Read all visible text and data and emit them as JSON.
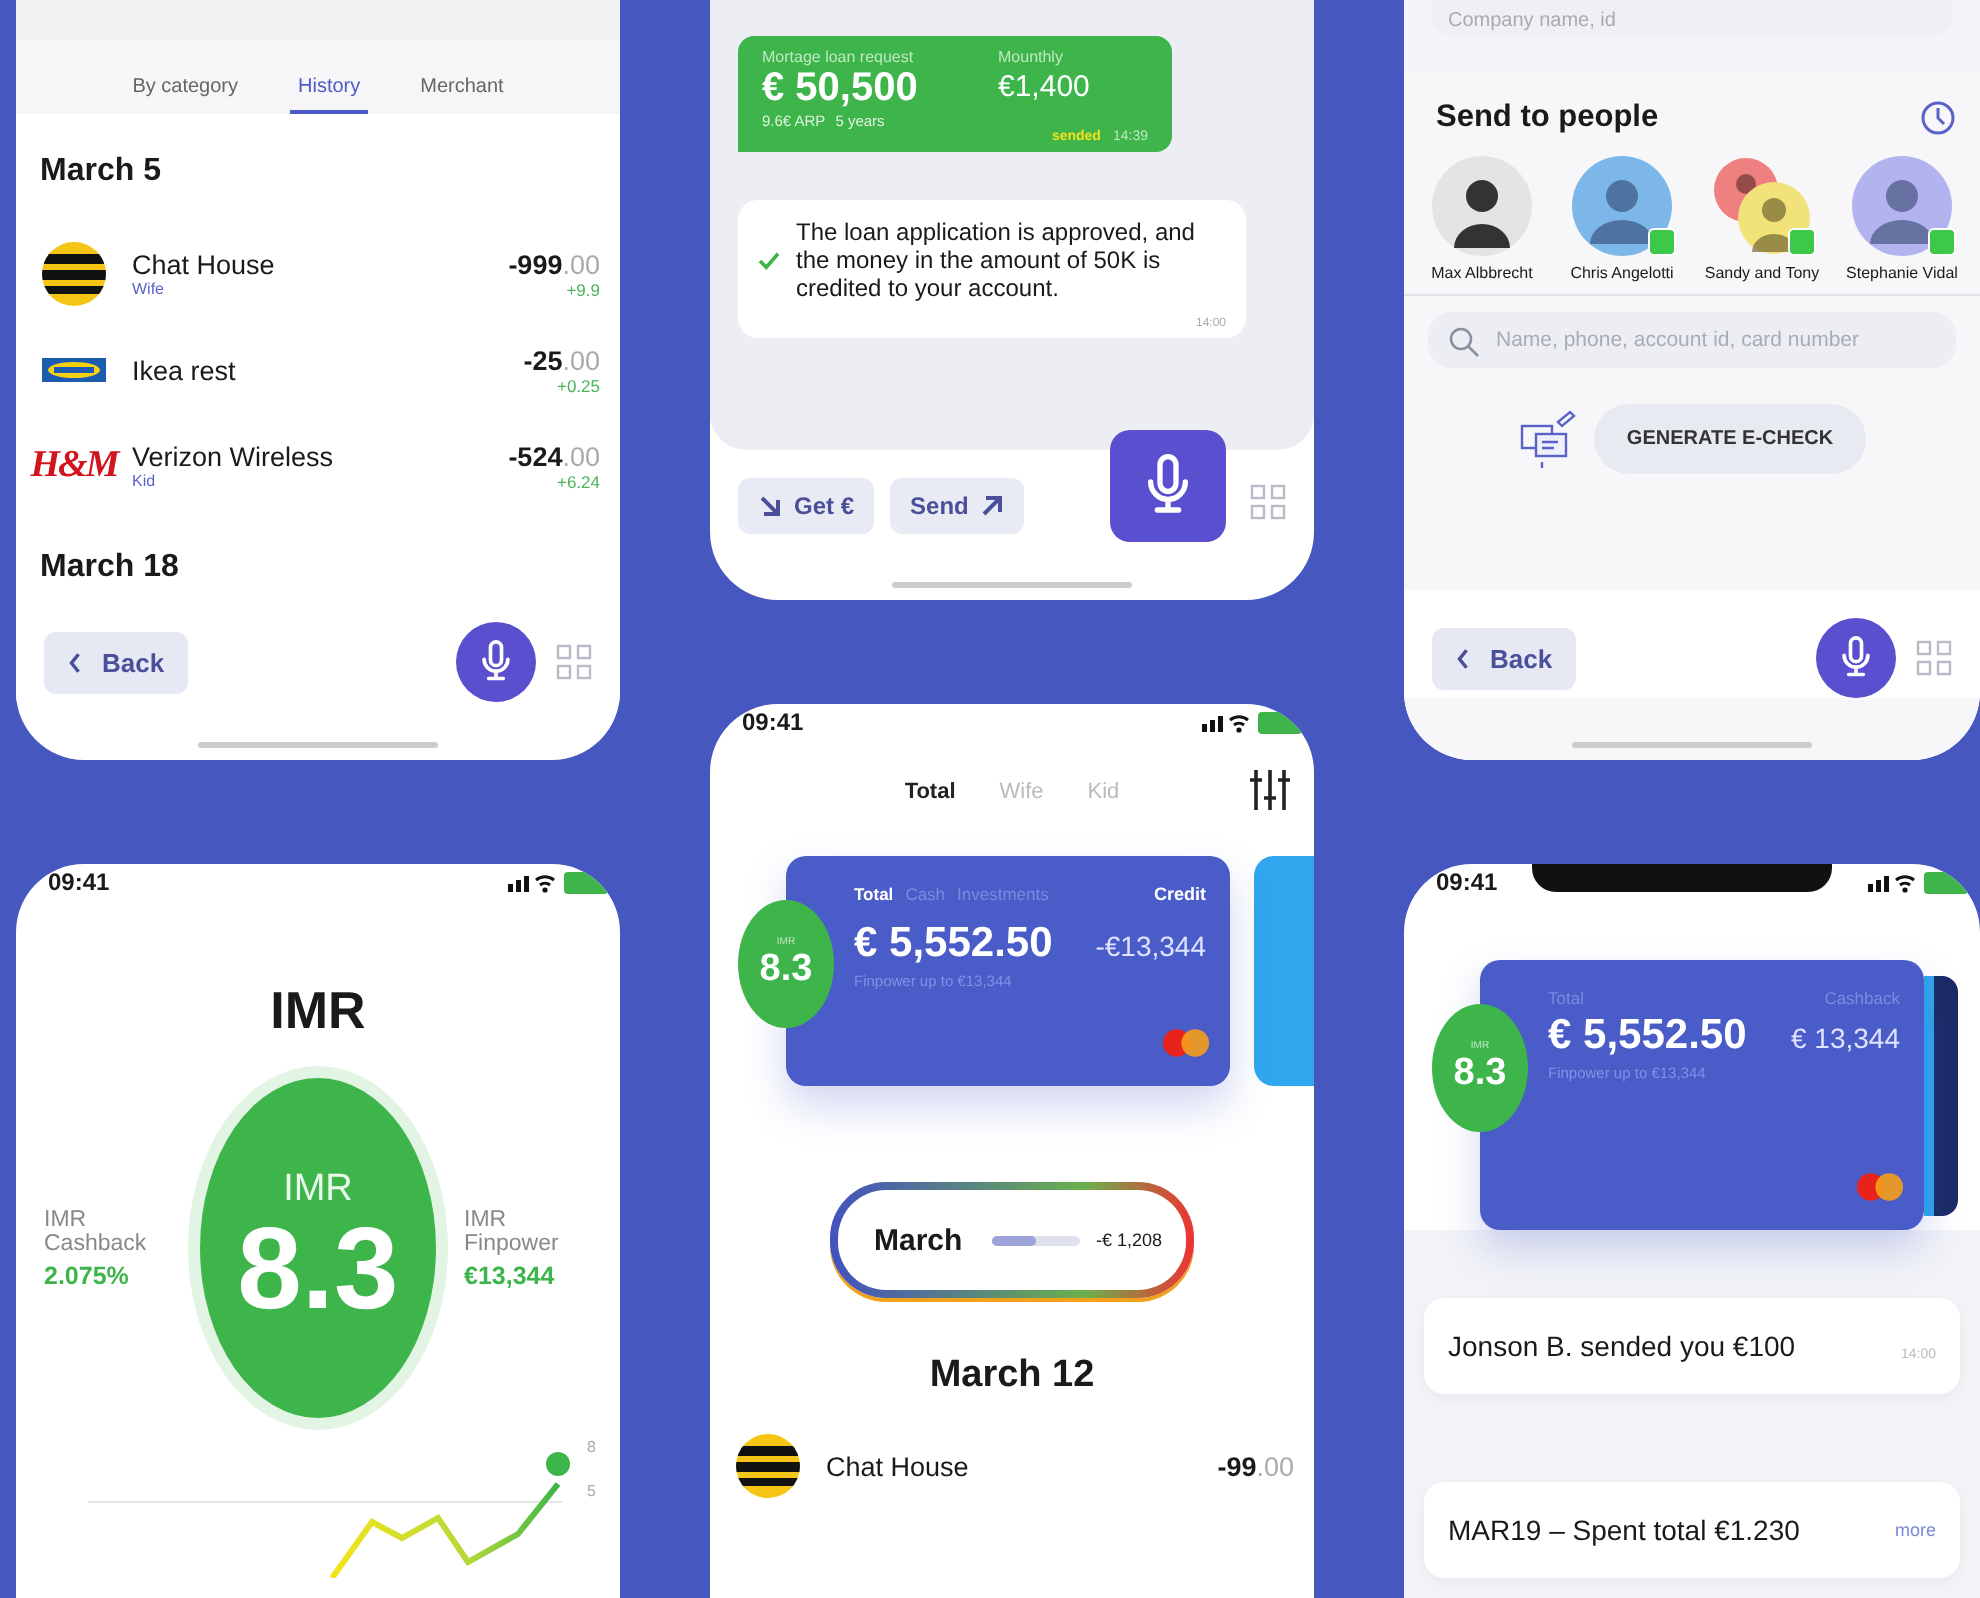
{
  "history_screen": {
    "tabs": [
      {
        "label": "By category",
        "selected": false
      },
      {
        "label": "History",
        "selected": true
      },
      {
        "label": "Merchant",
        "selected": false
      }
    ],
    "date": "March 5",
    "transactions": [
      {
        "kind": "stripes",
        "name": "Chat House",
        "tag": "Wife",
        "amount": "-999",
        "cents": ".00",
        "cashback": "+9.9"
      },
      {
        "kind": "ikea",
        "name": "Ikea rest",
        "amount": "-25",
        "cents": ".00",
        "cashback": "+0.25"
      },
      {
        "kind": "text",
        "logo_text": "H&M",
        "name": "Verizon Wireless",
        "tag": "Kid",
        "amount": "-524",
        "cents": ".00",
        "cashback": "+6.24"
      }
    ],
    "next_date": "March 18",
    "back_button": "Back"
  },
  "loan_chat_screen": {
    "request": {
      "label": "Mortage loan request",
      "amount": "€ 50,500",
      "rate": "9.6€ ARP",
      "term": "5 years",
      "monthly_label": "Mounthly",
      "monthly": "€1,400",
      "status": "sended",
      "time": "14:39"
    },
    "reply": {
      "text": "The loan application is approved, and the money in the amount of 50K is credited to your account.",
      "time": "14:00",
      "approved": true
    },
    "buttons": [
      {
        "kind": "get",
        "label": "Get €"
      },
      {
        "kind": "send",
        "label": "Send"
      }
    ]
  },
  "send_screen": {
    "company_search": {
      "placeholder": "Company name, id"
    },
    "title": "Send to people",
    "people": [
      {
        "name": "Max Albbrecht",
        "kind": "photo",
        "messenger": false
      },
      {
        "name": "Chris Angelotti",
        "kind": "single",
        "color": "#7db7ea",
        "messenger": true
      },
      {
        "name": "Sandy and Tony",
        "kind": "pair",
        "color": "#f2e27a",
        "messenger": true
      },
      {
        "name": "Stephanie Vidal",
        "kind": "single",
        "color": "#b3b3ef",
        "messenger": true
      }
    ],
    "search": {
      "placeholder": "Name, phone, account id, card number"
    },
    "echeck_button": "GENERATE E-CHECK",
    "back_button": "Back"
  },
  "imr_screen": {
    "time": "09:41",
    "title": "IMR",
    "score_label": "IMR",
    "score": "8.3",
    "cashback": {
      "label": "IMR Cashback",
      "value": "2.075%"
    },
    "finpower": {
      "label": "IMR Finpower",
      "value": "€13,344"
    },
    "chart_ticks": [
      "8",
      "5"
    ]
  },
  "overview_screen": {
    "time": "09:41",
    "tabs": [
      {
        "label": "Total",
        "selected": true
      },
      {
        "label": "Wife",
        "selected": false
      },
      {
        "label": "Kid",
        "selected": false
      }
    ],
    "card": {
      "score_label": "IMR",
      "score": "8.3",
      "tabs": [
        {
          "label": "Total",
          "selected": true
        },
        {
          "label": "Cash",
          "selected": false
        },
        {
          "label": "Investments",
          "selected": false
        }
      ],
      "credit_label": "Credit",
      "balance": "€ 5,552.50",
      "credit": "-€13,344",
      "note": "Finpower up to €13,344"
    },
    "month": {
      "label": "March",
      "level": 0.5,
      "amount": "-€ 1,208"
    },
    "date": "March 12",
    "transactions": [
      {
        "kind": "stripes",
        "name": "Chat House",
        "amount": "-99",
        "cents": ".00"
      }
    ]
  },
  "card_screen": {
    "time": "09:41",
    "card": {
      "score_label": "IMR",
      "score": "8.3",
      "balance_label": "Total",
      "balance": "€ 5,552.50",
      "note": "Finpower up to €13,344",
      "cashback_label": "Cashback",
      "cashback": "€ 13,344"
    },
    "notifications": [
      {
        "text": "Jonson B. sended you €100",
        "time": "14:00"
      },
      {
        "text": "MAR19 – Spent total €1.230",
        "link": "more"
      }
    ]
  }
}
